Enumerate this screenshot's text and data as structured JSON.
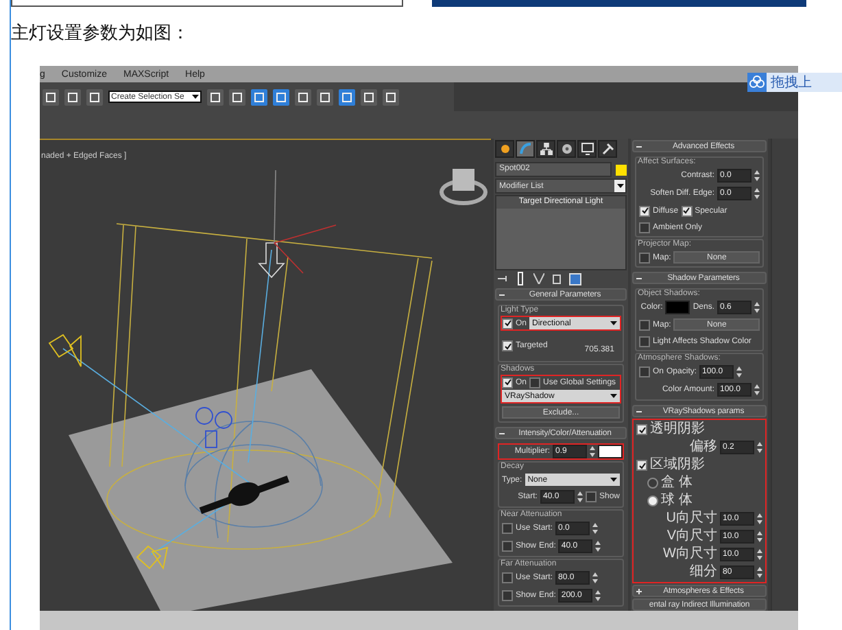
{
  "heading": "主灯设置参数为如图：",
  "menu": [
    "g",
    "Customize",
    "MAXScript",
    "Help"
  ],
  "toolbar": {
    "selection_set": "Create Selection Se"
  },
  "upload_button": {
    "label": "拖拽上"
  },
  "viewport": {
    "label": "naded + Edged Faces ]"
  },
  "command_panel": {
    "tabs": [
      {
        "selected": false
      },
      {
        "selected": true
      },
      {
        "selected": false
      },
      {
        "selected": false
      },
      {
        "selected": false
      },
      {
        "selected": false
      }
    ],
    "object_name": "Spot002",
    "modifier_list": "Modifier List",
    "stack": [
      "Target Directional Light"
    ]
  },
  "left_rollouts": [
    {
      "title": "General Parameters",
      "expanded": true,
      "blocks": [
        {
          "kind": "group",
          "label": "Light Type",
          "rows": [
            {
              "highlighted": true,
              "lines": [
                [
                  {
                    "kind": "check",
                    "label": "On",
                    "checked": true
                  },
                  {
                    "kind": "dropdown",
                    "value": "Directional"
                  }
                ]
              ]
            },
            {
              "lines": [
                [
                  {
                    "kind": "check",
                    "label": "Targeted",
                    "checked": true
                  },
                  {
                    "kind": "value",
                    "text": "705.381"
                  }
                ]
              ]
            }
          ]
        },
        {
          "kind": "group",
          "label": "Shadows",
          "rows": [
            {
              "highlighted": true,
              "lines": [
                [
                  {
                    "kind": "check",
                    "label": "On",
                    "checked": true
                  },
                  {
                    "kind": "check",
                    "label": "Use Global Settings",
                    "checked": false
                  }
                ],
                [
                  {
                    "kind": "dropdown",
                    "value": "VRayShadow"
                  }
                ]
              ]
            },
            {
              "lines": [
                [
                  {
                    "kind": "button",
                    "label": "Exclude..."
                  }
                ]
              ]
            }
          ]
        }
      ]
    },
    {
      "title": "Intensity/Color/Attenuation",
      "expanded": true,
      "blocks": [
        {
          "kind": "row",
          "highlighted": true,
          "lines": [
            [
              {
                "kind": "label",
                "text": "Multiplier:"
              },
              {
                "kind": "spinner",
                "value": "0.9"
              },
              {
                "kind": "swatch",
                "color": "#ffffff"
              }
            ]
          ]
        },
        {
          "kind": "group",
          "label": "Decay",
          "rows": [
            {
              "lines": [
                [
                  {
                    "kind": "label",
                    "text": "Type:"
                  },
                  {
                    "kind": "dropdown",
                    "value": "None"
                  }
                ]
              ]
            },
            {
              "lines": [
                [
                  {
                    "kind": "label",
                    "text": "Start:"
                  },
                  {
                    "kind": "spinner",
                    "value": "40.0"
                  },
                  {
                    "kind": "check",
                    "label": "Show",
                    "checked": false
                  }
                ]
              ]
            }
          ]
        },
        {
          "kind": "group",
          "label": "Near Attenuation",
          "rows": [
            {
              "lines": [
                [
                  {
                    "kind": "check",
                    "label": "Use",
                    "checked": false
                  },
                  {
                    "kind": "label",
                    "text": "Start:"
                  },
                  {
                    "kind": "spinner",
                    "value": "0.0"
                  }
                ]
              ]
            },
            {
              "lines": [
                [
                  {
                    "kind": "check",
                    "label": "Show",
                    "checked": false
                  },
                  {
                    "kind": "label",
                    "text": "End:"
                  },
                  {
                    "kind": "spinner",
                    "value": "40.0"
                  }
                ]
              ]
            }
          ]
        },
        {
          "kind": "group",
          "label": "Far Attenuation",
          "rows": [
            {
              "lines": [
                [
                  {
                    "kind": "check",
                    "label": "Use",
                    "checked": false
                  },
                  {
                    "kind": "label",
                    "text": "Start:"
                  },
                  {
                    "kind": "spinner",
                    "value": "80.0"
                  }
                ]
              ]
            },
            {
              "lines": [
                [
                  {
                    "kind": "check",
                    "label": "Show",
                    "checked": false
                  },
                  {
                    "kind": "label",
                    "text": "End:"
                  },
                  {
                    "kind": "spinner",
                    "value": "200.0"
                  }
                ]
              ]
            }
          ]
        }
      ]
    }
  ],
  "right_rollouts": [
    {
      "title": "Advanced Effects",
      "expanded": true,
      "blocks": [
        {
          "kind": "group",
          "label": "Affect Surfaces:",
          "rows": [
            {
              "lines": [
                [
                  {
                    "kind": "label",
                    "text": "Contrast:"
                  },
                  {
                    "kind": "spinner",
                    "value": "0.0"
                  }
                ]
              ]
            },
            {
              "lines": [
                [
                  {
                    "kind": "label",
                    "text": "Soften Diff. Edge:"
                  },
                  {
                    "kind": "spinner",
                    "value": "0.0"
                  }
                ]
              ]
            },
            {
              "lines": [
                [
                  {
                    "kind": "check",
                    "label": "Diffuse",
                    "checked": true
                  },
                  {
                    "kind": "check",
                    "label": "Specular",
                    "checked": true
                  }
                ]
              ]
            },
            {
              "lines": [
                [
                  {
                    "kind": "check",
                    "label": "Ambient Only",
                    "checked": false
                  }
                ]
              ]
            }
          ]
        },
        {
          "kind": "group",
          "label": "Projector Map:",
          "rows": [
            {
              "lines": [
                [
                  {
                    "kind": "check",
                    "label": "Map:",
                    "checked": false
                  },
                  {
                    "kind": "button",
                    "label": "None"
                  }
                ]
              ]
            }
          ]
        }
      ]
    },
    {
      "title": "Shadow Parameters",
      "expanded": true,
      "blocks": [
        {
          "kind": "group",
          "label": "Object Shadows:",
          "rows": [
            {
              "lines": [
                [
                  {
                    "kind": "label",
                    "text": "Color:"
                  },
                  {
                    "kind": "swatch",
                    "color": "#000000"
                  },
                  {
                    "kind": "label",
                    "text": "Dens."
                  },
                  {
                    "kind": "spinner",
                    "value": "0.6"
                  }
                ]
              ]
            },
            {
              "lines": [
                [
                  {
                    "kind": "check",
                    "label": "Map:",
                    "checked": false
                  },
                  {
                    "kind": "button",
                    "label": "None"
                  }
                ]
              ]
            },
            {
              "lines": [
                [
                  {
                    "kind": "check",
                    "label": "Light Affects Shadow Color",
                    "checked": false
                  }
                ]
              ]
            }
          ]
        },
        {
          "kind": "group",
          "label": "Atmosphere Shadows:",
          "rows": [
            {
              "lines": [
                [
                  {
                    "kind": "check",
                    "label": "On",
                    "checked": false
                  },
                  {
                    "kind": "label",
                    "text": "Opacity:"
                  },
                  {
                    "kind": "spinner",
                    "value": "100.0"
                  }
                ]
              ]
            },
            {
              "lines": [
                [
                  {
                    "kind": "label",
                    "text": "Color Amount:"
                  },
                  {
                    "kind": "spinner",
                    "value": "100.0"
                  }
                ]
              ]
            }
          ]
        }
      ]
    },
    {
      "title": "VRayShadows params",
      "expanded": true,
      "highlighted": true,
      "blocks": [
        {
          "kind": "row",
          "lines": [
            [
              {
                "kind": "check",
                "label": "透明阴影",
                "checked": true
              }
            ]
          ]
        },
        {
          "kind": "row",
          "lines": [
            [
              {
                "kind": "label",
                "text": "偏移"
              },
              {
                "kind": "spinner",
                "value": "0.2"
              }
            ]
          ]
        },
        {
          "kind": "row",
          "lines": [
            [
              {
                "kind": "check",
                "label": "区域阴影",
                "checked": true
              }
            ]
          ]
        },
        {
          "kind": "row",
          "lines": [
            [
              {
                "kind": "radio",
                "label": "盒 体",
                "selected": false
              }
            ]
          ]
        },
        {
          "kind": "row",
          "lines": [
            [
              {
                "kind": "radio",
                "label": "球 体",
                "selected": true
              }
            ]
          ]
        },
        {
          "kind": "row",
          "lines": [
            [
              {
                "kind": "label",
                "text": "U向尺寸"
              },
              {
                "kind": "spinner",
                "value": "10.0"
              }
            ]
          ]
        },
        {
          "kind": "row",
          "lines": [
            [
              {
                "kind": "label",
                "text": "V向尺寸"
              },
              {
                "kind": "spinner",
                "value": "10.0"
              }
            ]
          ]
        },
        {
          "kind": "row",
          "lines": [
            [
              {
                "kind": "label",
                "text": "W向尺寸"
              },
              {
                "kind": "spinner",
                "value": "10.0"
              }
            ]
          ]
        },
        {
          "kind": "row",
          "lines": [
            [
              {
                "kind": "label",
                "text": "细分"
              },
              {
                "kind": "spinner",
                "value": "80"
              }
            ]
          ]
        }
      ]
    },
    {
      "title": "Atmospheres & Effects",
      "expanded": false
    },
    {
      "title": "ental ray Indirect Illumination"
    }
  ]
}
